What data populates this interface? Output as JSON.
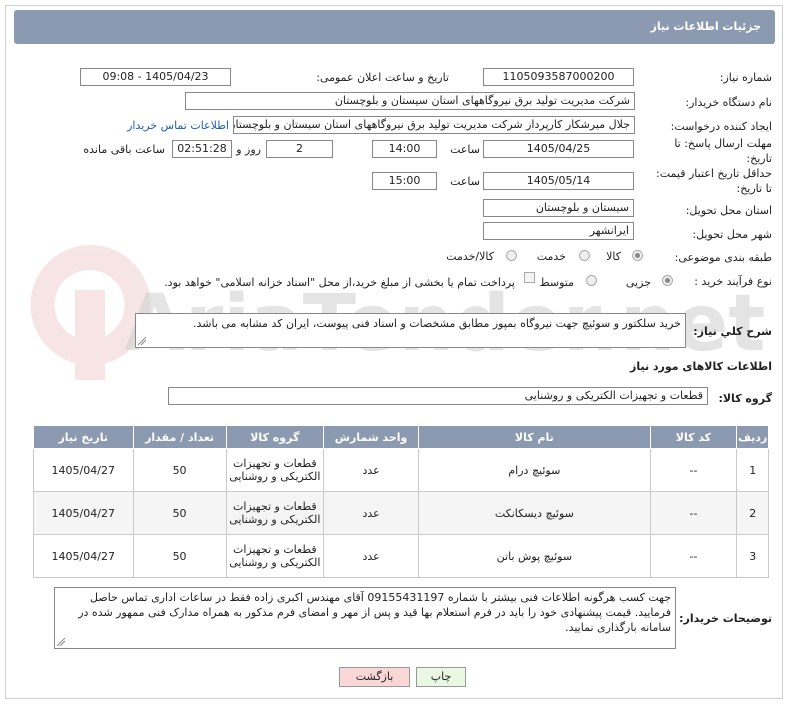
{
  "header": {
    "title": "جزئیات اطلاعات نیاز"
  },
  "form": {
    "need_number_label": "شماره نیاز:",
    "need_number": "1105093587000200",
    "announce_label": "تاریخ و ساعت اعلان عمومی:",
    "announce_value": "1405/04/23 - 09:08",
    "buyer_org_label": "نام دستگاه خریدار:",
    "buyer_org": "شرکت مدیریت تولید برق نیروگاههای استان سیستان و بلوچستان",
    "creator_label": "ایجاد کننده درخواست:",
    "creator": "جلال میرشکار کارپرداز شرکت مدیریت تولید برق نیروگاههای استان سیستان و بلوچستان",
    "buyer_contact_link": "اطلاعات تماس خریدار",
    "deadline_label_1": "مهلت ارسال پاسخ: تا",
    "deadline_label_2": "تاریخ:",
    "deadline_date": "1405/04/25",
    "time_label": "ساعت",
    "deadline_time": "14:00",
    "days_value": "2",
    "days_label": "روز و",
    "remaining_time": "02:51:28",
    "remaining_label": "ساعت باقی مانده",
    "validity_label_1": "حداقل تاریخ اعتبار قیمت:",
    "validity_label_2": "تا تاریخ:",
    "validity_date": "1405/05/14",
    "validity_time": "15:00",
    "province_label": "استان محل تحویل:",
    "province": "سیستان و بلوچستان",
    "city_label": "شهر محل تحویل:",
    "city": "ایرانشهر",
    "category_label": "طبقه بندی موضوعی:",
    "category_options": [
      "کالا",
      "خدمت",
      "کالا/خدمت"
    ],
    "process_label": "نوع فرآیند خرید :",
    "process_options": [
      "جزیی",
      "متوسط"
    ],
    "payment_note": "پرداخت تمام یا بخشی از مبلغ خرید،از محل \"اسناد خزانه اسلامی\" خواهد بود."
  },
  "description": {
    "label": "شرح کلي نياز:",
    "text": "خرید سلکتور و سوئیچ جهت نیروگاه بمپور مطابق مشخصات و اسناد فنی پیوست، ایران کد مشابه می باشد."
  },
  "goods": {
    "section_title": "اطلاعات کالاهای مورد نیاز",
    "group_label": "گروه کالا:",
    "group_value": "قطعات و تجهیزات الکتریکی و روشنایی",
    "columns": [
      "ردیف",
      "کد کالا",
      "نام کالا",
      "واحد شمارش",
      "گروه کالا",
      "تعداد / مقدار",
      "تاریخ نیاز"
    ],
    "rows": [
      {
        "row": "1",
        "code": "--",
        "name": "سوئیچ درام",
        "unit": "عدد",
        "group": "قطعات و تجهیزات الکتریکی و روشنایی",
        "qty": "50",
        "date": "1405/04/27"
      },
      {
        "row": "2",
        "code": "--",
        "name": "سوئیچ دیسکانکت",
        "unit": "عدد",
        "group": "قطعات و تجهیزات الکتریکی و روشنایی",
        "qty": "50",
        "date": "1405/04/27"
      },
      {
        "row": "3",
        "code": "--",
        "name": "سوئیچ پوش باتن",
        "unit": "عدد",
        "group": "قطعات و تجهیزات الکتریکی و روشنایی",
        "qty": "50",
        "date": "1405/04/27"
      }
    ]
  },
  "buyer_notes": {
    "label": "توضیحات خریدار:",
    "text": "جهت کسب هرگونه اطلاعات فنی بیشتر با شماره 09155431197 آقای مهندس اکبری زاده فقط در ساعات اداری تماس حاصل فرمایید. قیمت پیشنهادی خود را باید در فرم استعلام بها قید و پس از مهر و امضای فرم مذکور به همراه مدارک فنی ممهور شده در سامانه بارگذاری نمایید."
  },
  "buttons": {
    "print": "چاپ",
    "back": "بازگشت"
  },
  "watermark": "AriaTender.net",
  "colors": {
    "header": "#8b9ab0",
    "link": "#1f5fb0",
    "back_button": "#f9d7d7",
    "print_button": "#eaf7e3"
  }
}
